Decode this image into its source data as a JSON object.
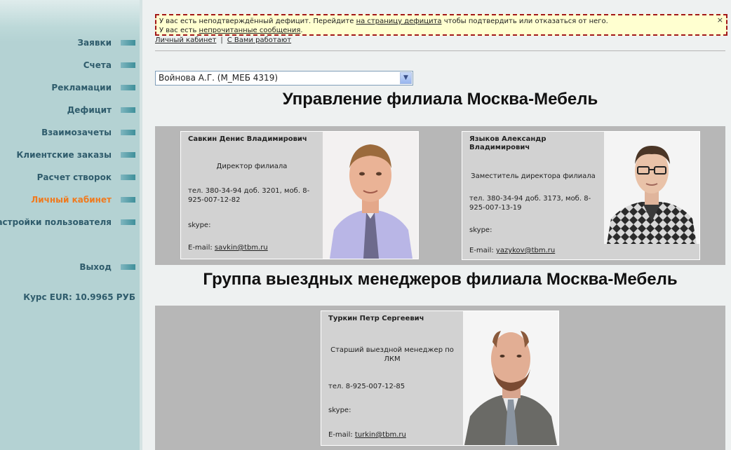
{
  "sidebar": {
    "items": [
      {
        "label": "Заявки",
        "active": false
      },
      {
        "label": "Счета",
        "active": false
      },
      {
        "label": "Рекламации",
        "active": false
      },
      {
        "label": "Дефицит",
        "active": false
      },
      {
        "label": "Взаимозачеты",
        "active": false
      },
      {
        "label": "Клиентские заказы",
        "active": false
      },
      {
        "label": "Расчет створок",
        "active": false
      },
      {
        "label": "Личный кабинет",
        "active": true
      },
      {
        "label": "Настройки пользователя",
        "active": false
      }
    ],
    "logout_label": "Выход",
    "rate": "Курс EUR: 10.9965 РУБ"
  },
  "notice": {
    "line1_prefix": "У вас есть неподтверждённый дефицит. Перейдите ",
    "line1_link": "на страницу дефицита",
    "line1_suffix": " чтобы подтвердить или отказаться от него.",
    "line2_prefix": "У вас есть ",
    "line2_link": "непрочитанные сообщения",
    "line2_suffix": ".",
    "close_symbol": "×"
  },
  "top_links": {
    "cabinet": "Личный кабинет",
    "separator": "|",
    "team": "С Вами работают"
  },
  "manager_select": {
    "value": "Войнова А.Г. (М_МЕБ 4319)",
    "arrow": "▼"
  },
  "sections": [
    {
      "title": "Управление филиала Москва-Мебель",
      "people": [
        {
          "name": "Савкин Денис Владимирович",
          "role": "Директор филиала",
          "phone": "тел. 380-34-94 доб. 3201, моб. 8-925-007-12-82",
          "skype": "skype:",
          "email_label": "E-mail: ",
          "email": "savkin@tbm.ru"
        },
        {
          "name": "Языков Александр Владимирович",
          "role": "Заместитель директора филиала",
          "phone": "тел. 380-34-94 доб. 3173, моб. 8-925-007-13-19",
          "skype": "skype:",
          "email_label": "E-mail: ",
          "email": "yazykov@tbm.ru"
        }
      ]
    },
    {
      "title": "Группа выездных менеджеров филиала Москва-Мебель",
      "people": [
        {
          "name": "Туркин Петр Сергеевич",
          "role": "Старший выездной менеджер по ЛКМ",
          "phone": "тел. 8-925-007-12-85",
          "skype": "skype:",
          "email_label": "E-mail: ",
          "email": "turkin@tbm.ru"
        }
      ]
    }
  ],
  "colors": {
    "sidebar_text": "#2f5c6c",
    "active_item": "#f07a1e",
    "notice_border": "#a31818",
    "notice_bg": "#ffffd0",
    "section_bg": "#b7b7b7"
  }
}
